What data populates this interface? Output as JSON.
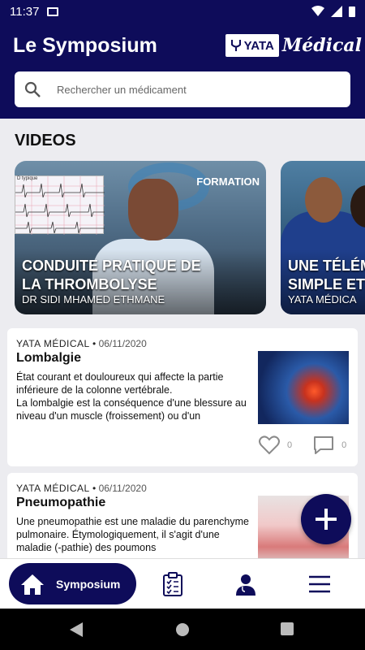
{
  "status_bar": {
    "time": "11:37"
  },
  "header": {
    "title": "Le Symposium",
    "logo_box_text": "YATA",
    "logo_script_text": "Médical"
  },
  "search": {
    "placeholder": "Rechercher un médicament"
  },
  "videos": {
    "section_title": "VIDEOS",
    "items": [
      {
        "badge": "FORMATION",
        "title": "CONDUITE PRATIQUE DE\nLA THROMBOLYSE",
        "subtitle": "DR SIDI MHAMED ETHMANE",
        "thumb_label": "D typique"
      },
      {
        "title": "UNE TÉLÉM\nSIMPLE ET",
        "subtitle": "YATA MÉDICA"
      }
    ]
  },
  "articles": [
    {
      "source": "YATA MÉDICAL",
      "date": "06/11/2020",
      "title": "Lombalgie",
      "excerpt": "État courant et douloureux qui affecte la partie inférieure de la colonne vertébrale.\nLa lombalgie est la conséquence d'une blessure au niveau d'un muscle (froissement) ou d'un",
      "likes": "0",
      "comments": "0"
    },
    {
      "source": "YATA MÉDICAL",
      "date": "06/11/2020",
      "title": "Pneumopathie",
      "excerpt": "Une pneumopathie est une maladie du parenchyme pulmonaire. Étymologiquement, il s'agit d'une maladie (-pathie) des poumons"
    }
  ],
  "bottom_nav": {
    "active_label": "Symposium",
    "items": [
      "home-icon",
      "clipboard-icon",
      "doctor-icon",
      "menu-icon"
    ]
  },
  "colors": {
    "primary": "#0e0c5a",
    "background": "#ececf0"
  }
}
